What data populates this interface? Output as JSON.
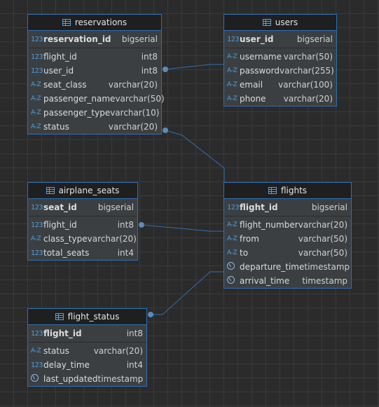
{
  "tables": {
    "reservations": {
      "title": "reservations",
      "pk": {
        "name": "reservation_id",
        "type": "bigserial",
        "icon": "123"
      },
      "cols": [
        {
          "name": "flight_id",
          "type": "int8",
          "icon": "123"
        },
        {
          "name": "user_id",
          "type": "int8",
          "icon": "123"
        },
        {
          "name": "seat_class",
          "type": "varchar(20)",
          "icon": "A-Z"
        },
        {
          "name": "passenger_name",
          "type": "varchar(50)",
          "icon": "A-Z"
        },
        {
          "name": "passenger_type",
          "type": "varchar(10)",
          "icon": "A-Z"
        },
        {
          "name": "status",
          "type": "varchar(20)",
          "icon": "A-Z"
        }
      ]
    },
    "users": {
      "title": "users",
      "pk": {
        "name": "user_id",
        "type": "bigserial",
        "icon": "123"
      },
      "cols": [
        {
          "name": "username",
          "type": "varchar(50)",
          "icon": "A-Z"
        },
        {
          "name": "password",
          "type": "varchar(255)",
          "icon": "A-Z"
        },
        {
          "name": "email",
          "type": "varchar(100)",
          "icon": "A-Z"
        },
        {
          "name": "phone",
          "type": "varchar(20)",
          "icon": "A-Z"
        }
      ]
    },
    "airplane_seats": {
      "title": "airplane_seats",
      "pk": {
        "name": "seat_id",
        "type": "bigserial",
        "icon": "123"
      },
      "cols": [
        {
          "name": "flight_id",
          "type": "int8",
          "icon": "123"
        },
        {
          "name": "class_type",
          "type": "varchar(20)",
          "icon": "A-Z"
        },
        {
          "name": "total_seats",
          "type": "int4",
          "icon": "123"
        }
      ]
    },
    "flights": {
      "title": "flights",
      "pk": {
        "name": "flight_id",
        "type": "bigserial",
        "icon": "123"
      },
      "cols": [
        {
          "name": "flight_number",
          "type": "varchar(20)",
          "icon": "A-Z"
        },
        {
          "name": "from",
          "type": "varchar(50)",
          "icon": "A-Z"
        },
        {
          "name": "to",
          "type": "varchar(50)",
          "icon": "A-Z"
        },
        {
          "name": "departure_time",
          "type": "timestamp",
          "icon": "clock"
        },
        {
          "name": "arrival_time",
          "type": "timestamp",
          "icon": "clock"
        }
      ]
    },
    "flight_status": {
      "title": "flight_status",
      "pk": {
        "name": "flight_id",
        "type": "int8",
        "icon": "123"
      },
      "cols": [
        {
          "name": "status",
          "type": "varchar(20)",
          "icon": "A-Z"
        },
        {
          "name": "delay_time",
          "type": "int4",
          "icon": "123"
        },
        {
          "name": "last_updated",
          "type": "timestamp",
          "icon": "clock"
        }
      ]
    }
  },
  "colors": {
    "border": "#2f6fb3",
    "connector": "#2f6fb3",
    "background": "#2b2b2b"
  }
}
